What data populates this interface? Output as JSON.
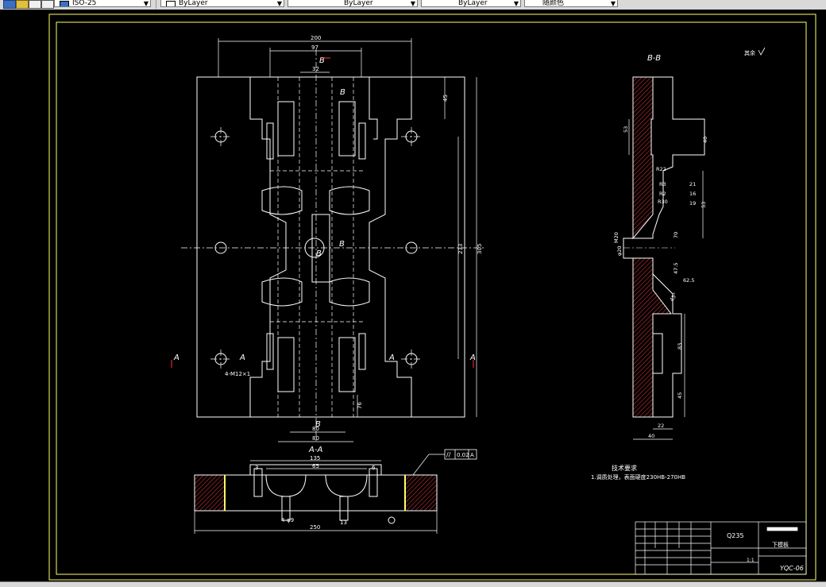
{
  "toolbar": {
    "style_value": "ISO-25",
    "linetype_value": "ByLayer",
    "lineweight_value": "ByLayer",
    "plotstyle_value": "ByLayer",
    "color_value": "随颜色"
  },
  "drawing": {
    "dim_200": "200",
    "dim_97": "97",
    "dim_32": "32",
    "dim_45": "45",
    "dim_233": "233",
    "dim_305": "305",
    "dim_76": "76",
    "dim_80a": "80",
    "dim_80b": "80",
    "label_M12": "4-M12×1",
    "sec_B_top": "B",
    "sec_B_right": "B",
    "sec_B_center": "B",
    "sec_B_center2": "B",
    "sec_B_bottom": "B",
    "sec_A_left": "A",
    "sec_A_right": "A",
    "sec_A_mid": "A",
    "view_AA_title": "A-A",
    "dim_135": "135",
    "dim_65": "65",
    "dim_3": "3",
    "dim_6": "6",
    "dim_250": "250",
    "dim_4phi": "4-φ9",
    "dim_13": "13",
    "tolerance_sym": "//",
    "tolerance_val": "0.02",
    "tolerance_ref": "A",
    "view_BB_title": "B-B",
    "roughness_note": "其余",
    "dim_53": "53",
    "dim_40": "40",
    "dim_r22": "R22",
    "dim_r3": "R3",
    "dim_r2": "R2",
    "dim_21": "21",
    "dim_16": "16",
    "dim_19": "19",
    "dim_53b": "53",
    "dim_r30": "R30",
    "dim_phi20": "φ20",
    "dim_m": "M20",
    "dim_70": "70",
    "dim_475": "47.5",
    "dim_625": "62.5",
    "dim_45deg": "45°",
    "dim_83": "83",
    "dim_45b": "45",
    "dim_22b": "22",
    "dim_40b": "40",
    "tech_title": "技术要求",
    "tech_req": "1.调质处理，表面硬度230HB-270HB",
    "title_material": "Q235",
    "title_name": "下模板",
    "title_code": "YQC-06",
    "title_scale": "1:1"
  },
  "colors": {
    "background": "#000000",
    "lines": "#ffffff",
    "dims": "#ffffff",
    "frame": "#ffff66",
    "hatch": "#cc3333",
    "centerline": "#ffffff",
    "arrow_red": "#ff3333"
  }
}
